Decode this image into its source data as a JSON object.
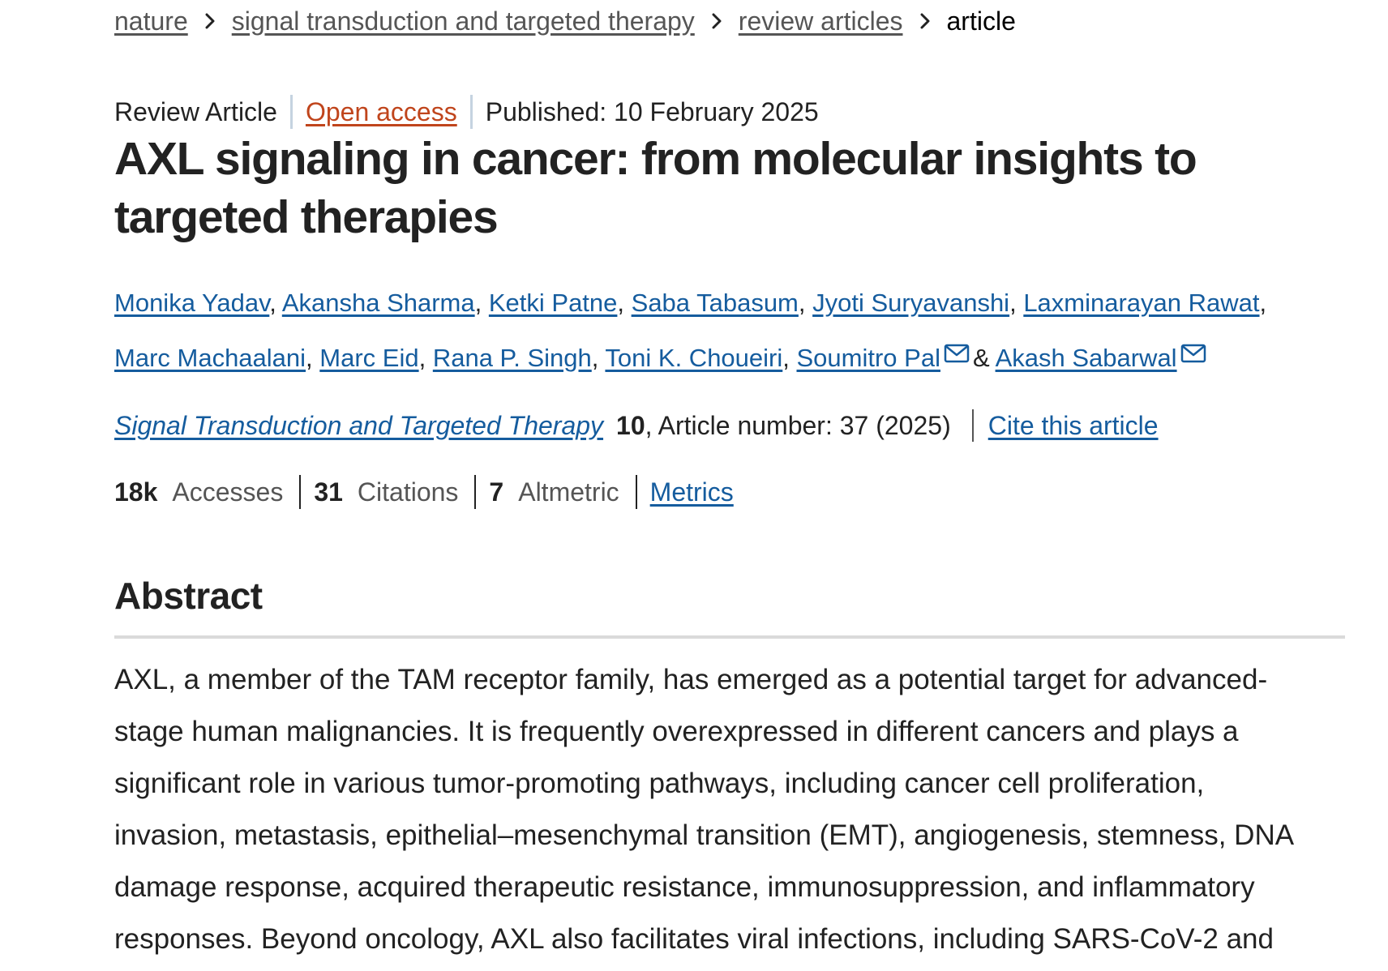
{
  "breadcrumb": {
    "items": [
      "nature",
      "signal transduction and targeted therapy",
      "review articles"
    ],
    "current": "article"
  },
  "meta": {
    "type": "Review Article",
    "open_access": "Open access",
    "published": "Published: 10 February 2025"
  },
  "title": "AXL signaling in cancer: from molecular insights to targeted therapies",
  "authors": {
    "row1": [
      "Monika Yadav",
      "Akansha Sharma",
      "Ketki Patne",
      "Saba Tabasum",
      "Jyoti Suryavanshi",
      "Laxminarayan Rawat"
    ],
    "row2": [
      "Marc Machaalani",
      "Marc Eid",
      "Rana P. Singh",
      "Toni K. Choueiri"
    ],
    "corresponding": [
      "Soumitro Pal",
      "Akash Sabarwal"
    ],
    "ampersand": "&",
    "mail_icon": "envelope-icon"
  },
  "citation": {
    "journal": "Signal Transduction and Targeted Therapy",
    "volume": "10",
    "article_number": ", Article number: 37 (2025)",
    "cite_link": "Cite this article"
  },
  "metrics": {
    "accesses_value": "18k",
    "accesses_label": "Accesses",
    "citations_value": "31",
    "citations_label": "Citations",
    "altmetric_value": "7",
    "altmetric_label": "Altmetric",
    "metrics_link": "Metrics"
  },
  "abstract": {
    "heading": "Abstract",
    "lines": [
      "AXL, a member of the TAM receptor family, has emerged as a potential target for advanced-",
      "stage human malignancies. It is frequently overexpressed in different cancers and plays a",
      "significant role in various tumor-promoting pathways, including cancer cell proliferation,",
      "invasion, metastasis, epithelial–mesenchymal transition (EMT), angiogenesis, stemness, DNA",
      "damage response, acquired therapeutic resistance, immunosuppression, and inflammatory",
      "responses. Beyond oncology, AXL also facilitates viral infections, including SARS-CoV-2 and"
    ]
  },
  "colors": {
    "link": "#155c9e",
    "open_access": "#c0451c",
    "text": "#222222"
  }
}
